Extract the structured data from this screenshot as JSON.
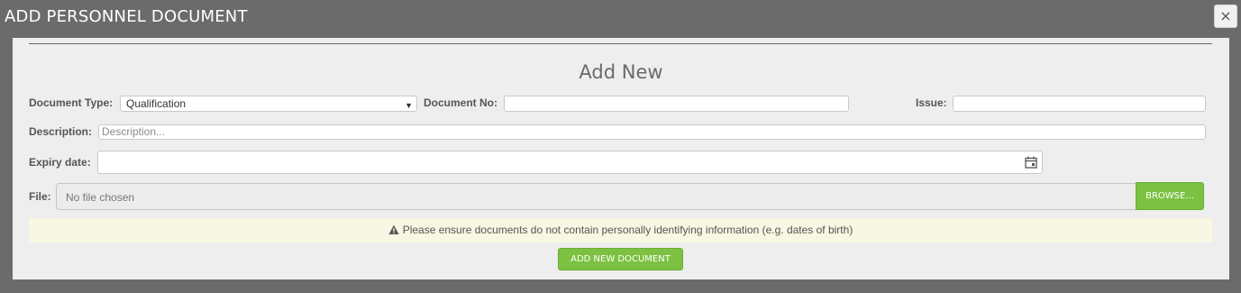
{
  "modal": {
    "title": "ADD PERSONNEL DOCUMENT",
    "close_label": "×"
  },
  "form": {
    "heading": "Add New",
    "document_type": {
      "label": "Document Type:",
      "selected": "Qualification"
    },
    "document_no": {
      "label": "Document No:",
      "value": ""
    },
    "issue": {
      "label": "Issue:",
      "value": ""
    },
    "description": {
      "label": "Description:",
      "placeholder": "Description..."
    },
    "expiry_date": {
      "label": "Expiry date:",
      "value": "",
      "icon": "calendar-icon"
    },
    "file": {
      "label": "File:",
      "status": "No file chosen",
      "browse_label": "BROWSE..."
    },
    "warning": {
      "icon": "warning-icon",
      "text": "Please ensure documents do not contain personally identifying information (e.g. dates of birth)"
    },
    "submit_label": "ADD NEW DOCUMENT"
  },
  "colors": {
    "accent_green": "#7cc142",
    "warning_bg": "#f8f7e3",
    "backdrop": "#6b6b6b"
  }
}
